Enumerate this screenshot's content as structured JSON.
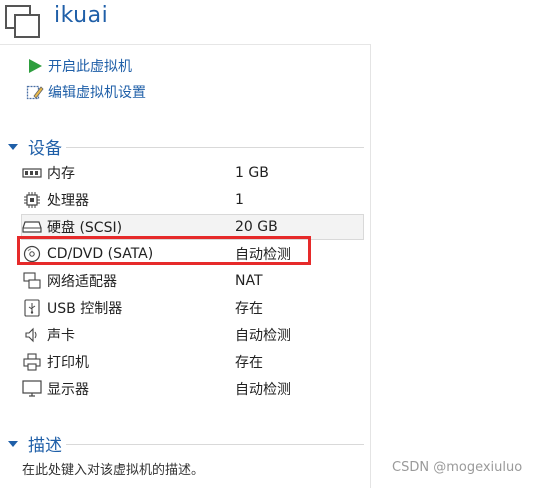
{
  "vm": {
    "name": "ikuai"
  },
  "actions": [
    {
      "label": "开启此虚拟机",
      "icon": "play-icon"
    },
    {
      "label": "编辑虚拟机设置",
      "icon": "edit-settings-icon"
    }
  ],
  "devices_section": {
    "title": "设备"
  },
  "devices": [
    {
      "name": "内存",
      "value": "1 GB",
      "icon": "memory-icon"
    },
    {
      "name": "处理器",
      "value": "1",
      "icon": "processor-icon"
    },
    {
      "name": "硬盘 (SCSI)",
      "value": "20 GB",
      "icon": "hard-disk-icon"
    },
    {
      "name": "CD/DVD (SATA)",
      "value": "自动检测",
      "icon": "cd-dvd-icon"
    },
    {
      "name": "网络适配器",
      "value": "NAT",
      "icon": "network-adapter-icon"
    },
    {
      "name": "USB 控制器",
      "value": "存在",
      "icon": "usb-icon"
    },
    {
      "name": "声卡",
      "value": "自动检测",
      "icon": "sound-card-icon"
    },
    {
      "name": "打印机",
      "value": "存在",
      "icon": "printer-icon"
    },
    {
      "name": "显示器",
      "value": "自动检测",
      "icon": "display-icon"
    }
  ],
  "description_section": {
    "title": "描述",
    "placeholder": "在此处键入对该虚拟机的描述。"
  },
  "watermark": "CSDN @mogexiuluo",
  "colors": {
    "accent": "#1f5fa8",
    "highlight": "#e62a2a",
    "play": "#2e9e3e"
  }
}
